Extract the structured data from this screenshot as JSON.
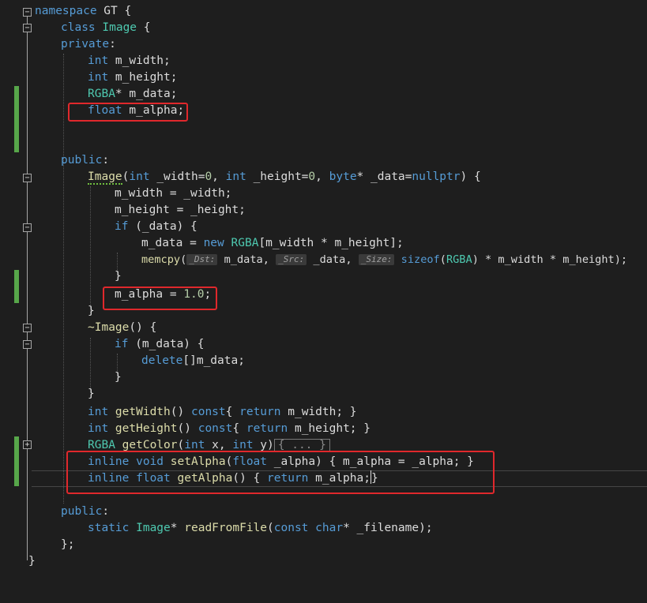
{
  "code": {
    "l1": {
      "kw": "namespace",
      "rest": " GT {"
    },
    "l2": {
      "kw": "class",
      "ty": "Image",
      "rest": " {"
    },
    "l3": {
      "kw": "private",
      "rest": ":"
    },
    "l4": {
      "kw": "int",
      "rest": " m_width;"
    },
    "l5": {
      "kw": "int",
      "rest": " m_height;"
    },
    "l6": {
      "ty": "RGBA",
      "rest": "* m_data;"
    },
    "l7": {
      "kw": "float",
      "rest": " m_alpha;"
    },
    "l10": {
      "kw": "public",
      "rest": ":"
    },
    "l11": {
      "fn": "Image",
      "p1": "(",
      "kw1": "int",
      "a1": " _width=",
      "n1": "0",
      "c1": ", ",
      "kw2": "int",
      "a2": " _height=",
      "n2": "0",
      "c2": ", ",
      "kw3": "byte",
      "a3": "* _data=",
      "kw4": "nullptr",
      "rest": ") {"
    },
    "l12": {
      "text": "m_width = _width;"
    },
    "l13": {
      "text": "m_height = _height;"
    },
    "l14": {
      "kw": "if",
      "rest": " (_data) {"
    },
    "l15": {
      "a": "m_data = ",
      "kw": "new",
      "ty": " RGBA",
      "rest": "[m_width * m_height];"
    },
    "l16": {
      "fn": "memcpy",
      "p": "(",
      "h1": "_Dst:",
      "a1": " m_data, ",
      "h2": "_Src:",
      "a2": " _data, ",
      "h3": "_Size:",
      "kw": " sizeof",
      "p2": "(",
      "ty": "RGBA",
      "rest": ") * m_width * m_height);"
    },
    "l17": {
      "text": "}"
    },
    "l18": {
      "a": "m_alpha = ",
      "n": "1.0",
      "rest": ";"
    },
    "l19": {
      "text": "}"
    },
    "l20": {
      "fn": "~Image",
      "rest": "() {"
    },
    "l21": {
      "kw": "if",
      "rest": " (m_data) {"
    },
    "l22": {
      "kw": "delete",
      "rest": "[]m_data;"
    },
    "l23": {
      "text": "}"
    },
    "l24": {
      "text": "}"
    },
    "l25": {
      "kw": "int",
      "fn": " getWidth",
      "p": "() ",
      "kw2": "const",
      "a": "{ ",
      "kw3": "return",
      "rest": " m_width; }"
    },
    "l26": {
      "kw": "int",
      "fn": " getHeight",
      "p": "() ",
      "kw2": "const",
      "a": "{ ",
      "kw3": "return",
      "rest": " m_height; }"
    },
    "l27": {
      "ty": "RGBA",
      "fn": " getColor",
      "p": "(",
      "kw1": "int",
      "a1": " x, ",
      "kw2": "int",
      "a2": " y)",
      "fold": "{ ... }"
    },
    "l28": {
      "kw": "inline",
      "kw2": " void",
      "fn": " setAlpha",
      "p": "(",
      "kw3": "float",
      "rest": " _alpha) { m_alpha = _alpha; }"
    },
    "l29": {
      "kw": "inline",
      "kw2": " float",
      "fn": " getAlpha",
      "p": "() { ",
      "kw3": "return",
      "rest": " m_alpha;",
      "close": "}"
    },
    "l31": {
      "kw": "public",
      "rest": ":"
    },
    "l32": {
      "kw": "static",
      "ty": " Image",
      "a": "* ",
      "fn": "readFromFile",
      "p": "(",
      "kw2": "const",
      "kw3": " char",
      "rest": "* _filename);"
    },
    "l33": {
      "text": "};"
    },
    "l34": {
      "text": "}"
    }
  },
  "gutter": {
    "fold_minus": "−",
    "fold_plus": "+"
  },
  "colors": {
    "keyword": "#569cd6",
    "type": "#4ec9b0",
    "function": "#dcdcaa",
    "number": "#b5cea8",
    "highlight_box": "#e0282c",
    "change_bar": "#57a64a"
  }
}
